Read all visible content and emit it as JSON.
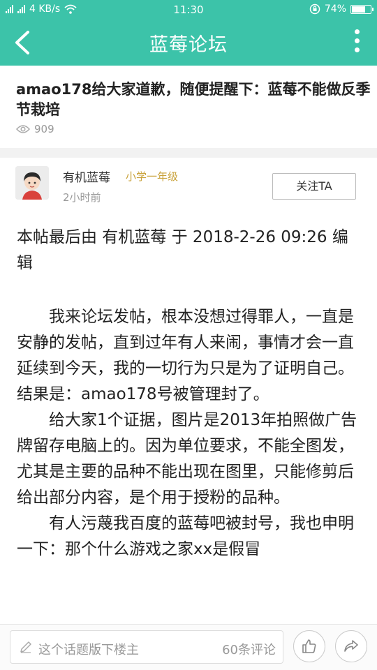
{
  "status": {
    "carrier": "4G",
    "speed": "4 KB/s",
    "time": "11:30",
    "battery": "74%",
    "battery_level": 0.74
  },
  "header": {
    "title": "蓝莓论坛"
  },
  "post": {
    "title": "amao178给大家道歉，随便提醒下：蓝莓不能做反季节栽培",
    "views": "909",
    "author": {
      "name": "有机蓝莓",
      "level": "小学一年级",
      "time": "2小时前",
      "follow_label": "关注TA"
    },
    "edit_note": " 本帖最后由 有机蓝莓 于 2018-2-26 09:26 编辑",
    "paragraphs": [
      "我来论坛发帖，根本没想过得罪人，一直是安静的发帖，直到过年有人来闹，事情才会一直延续到今天，我的一切行为只是为了证明自己。结果是：amao178号被管理封了。",
      "给大家1个证据，图片是2013年拍照做广告牌留存电脑上的。因为单位要求，不能全图发，尤其是主要的品种不能出现在图里，只能修剪后给出部分内容，是个用于授粉的品种。",
      "有人污蔑我百度的蓝莓吧被封号，我也申明一下：那个什么游戏之家xx是假冒"
    ]
  },
  "bottom": {
    "comment_placeholder": "这个话题版下楼主",
    "comment_count": "60条评论"
  },
  "colors": {
    "accent": "#3cc3a9",
    "level": "#c9a23a"
  }
}
